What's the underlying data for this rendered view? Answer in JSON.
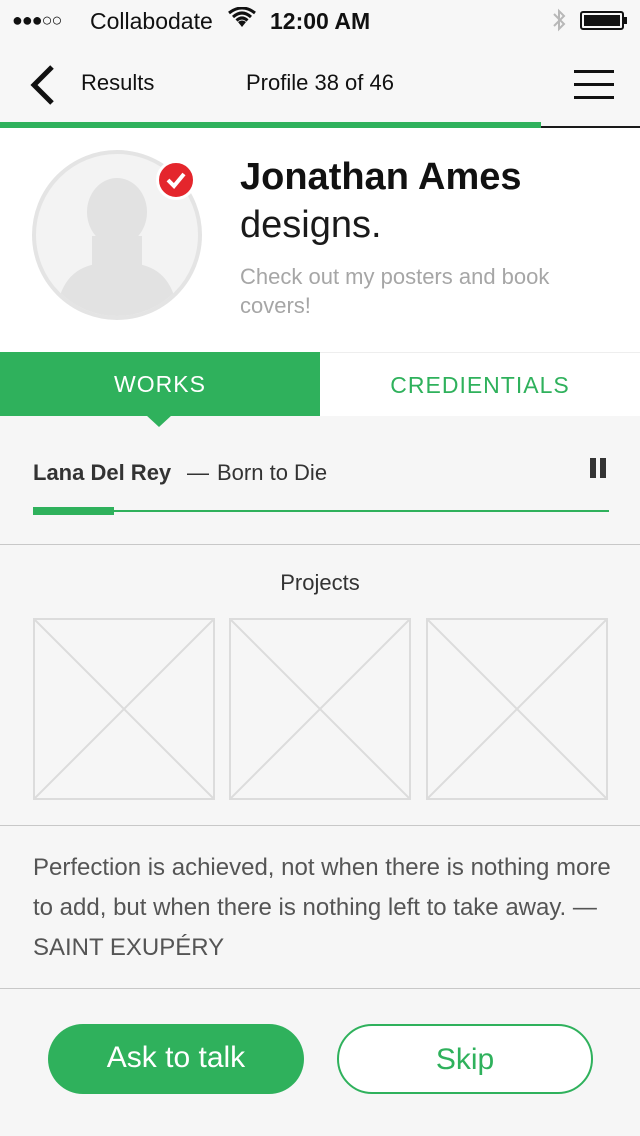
{
  "status_bar": {
    "signal": "●●●○○",
    "carrier": "Collabodate",
    "time": "12:00 AM",
    "icons": [
      "wifi-icon",
      "bluetooth-icon",
      "battery-icon"
    ]
  },
  "nav": {
    "back_label": "Results",
    "title": "Profile 38 of 46",
    "progress_fraction": 0.8453
  },
  "profile": {
    "name": "Jonathan Ames",
    "role": "designs.",
    "bio": "Check out my posters and book covers!",
    "verified": true
  },
  "tabs": [
    {
      "label": "WORKS",
      "active": true
    },
    {
      "label": "CREDIENTIALS",
      "active": false
    }
  ],
  "now_playing": {
    "artist": "Lana Del Rey",
    "separator": "—",
    "song": "Born to Die",
    "progress_fraction": 0.14
  },
  "projects": {
    "title": "Projects",
    "items": 3
  },
  "quote": "Perfection is achieved, not when there is nothing more to add, but when there is nothing left to take away. — SAINT EXUPÉRY",
  "actions": {
    "primary_label": "Ask to talk",
    "secondary_label": "Skip"
  },
  "colors": {
    "accent": "#2fb15c",
    "verified": "#e4262c"
  }
}
